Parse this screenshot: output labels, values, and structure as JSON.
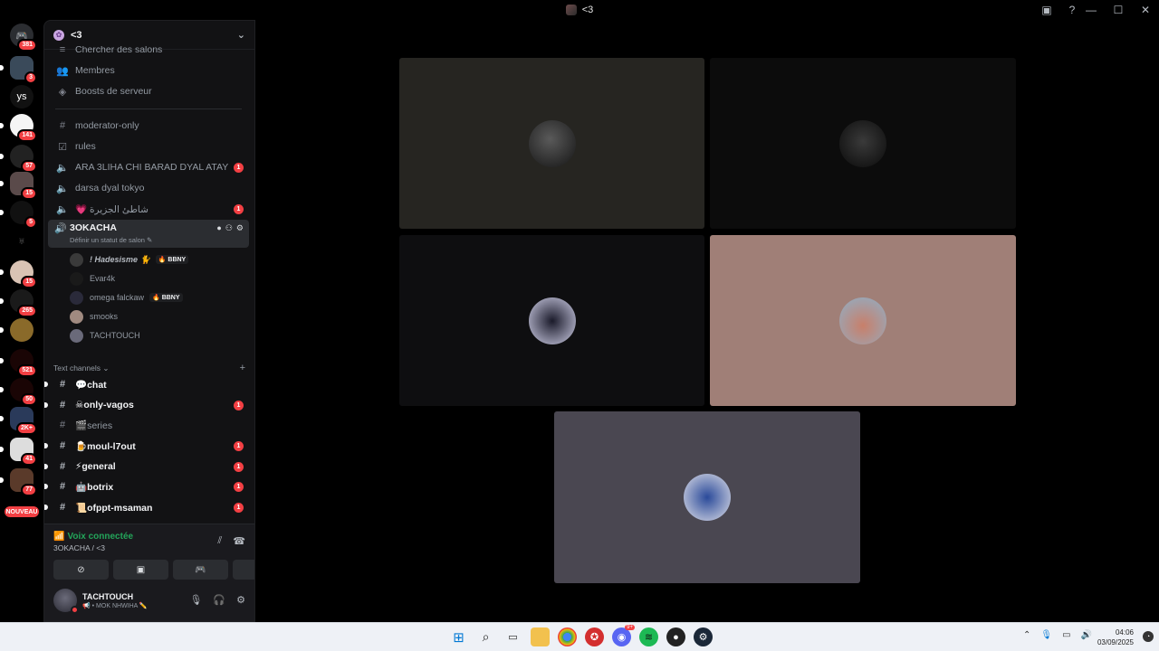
{
  "window": {
    "title": "<3",
    "minimize": "—",
    "maximize": "☐",
    "close": "✕"
  },
  "rail": {
    "badges": {
      "home": "381",
      "g1": "3",
      "g2_label": "ys",
      "g3": "141",
      "g4": "57",
      "g5": "15",
      "g6": "5",
      "g8": "15",
      "g9": "265",
      "g11": "521",
      "g12": "50",
      "g13": "2K+",
      "g14": "41",
      "g15": "77",
      "new": "NOUVEAU"
    }
  },
  "server": {
    "name": "<3",
    "menu": [
      {
        "label": "Chercher des salons"
      },
      {
        "label": "Membres"
      },
      {
        "label": "Boosts de serveur"
      }
    ],
    "channels_top": [
      {
        "label": "moderator-only",
        "badge": ""
      },
      {
        "label": "rules",
        "badge": ""
      },
      {
        "label": "ARA 3LIHA CHI BARAD DYAL ATAY",
        "badge": "1"
      },
      {
        "label": "darsa dyal tokyo",
        "badge": ""
      },
      {
        "label": "💗 شاطئ الجزيرة",
        "badge": "1"
      }
    ],
    "active_voice": {
      "name": "3OKACHA",
      "status": "Définir un statut de salon ✎"
    },
    "voice_users": [
      {
        "name": "! Hadesisme 🐈",
        "tag": "🔥 BBNY"
      },
      {
        "name": "Evar4k",
        "tag": ""
      },
      {
        "name": "omega falckaw",
        "tag": "🔥 BBNY"
      },
      {
        "name": "smooks",
        "tag": ""
      },
      {
        "name": "TACHTOUCH",
        "tag": ""
      }
    ],
    "category": "Text channels ⌄",
    "category_plus": "+",
    "text_channels": [
      {
        "label": "💬chat",
        "badge": ""
      },
      {
        "label": "☠only-vagos",
        "badge": "1"
      },
      {
        "label": "🎬series",
        "badge": ""
      },
      {
        "label": "🍺moul-l7out",
        "badge": "1"
      },
      {
        "label": "⚡general",
        "badge": "1"
      },
      {
        "label": "🤖botrix",
        "badge": "1"
      },
      {
        "label": "📜ofppt-msaman",
        "badge": "1"
      }
    ]
  },
  "voice_panel": {
    "status": "Voix connectée",
    "channel": "3OKACHA / <3"
  },
  "user": {
    "name": "TACHTOUCH",
    "status": "📢 • MOK NHWIHA ✏️"
  },
  "taskbar": {
    "time": "04:06",
    "date": "03/09/2025",
    "discord_badge": "9+"
  },
  "colors": {
    "tile1": "#262521",
    "tile2": "#0c0c0c",
    "tile3": "#0e0e10",
    "tile4": "#a07f77",
    "tile5": "#4a4751",
    "accent_red": "#f23f43",
    "voice_green": "#23a55a"
  }
}
